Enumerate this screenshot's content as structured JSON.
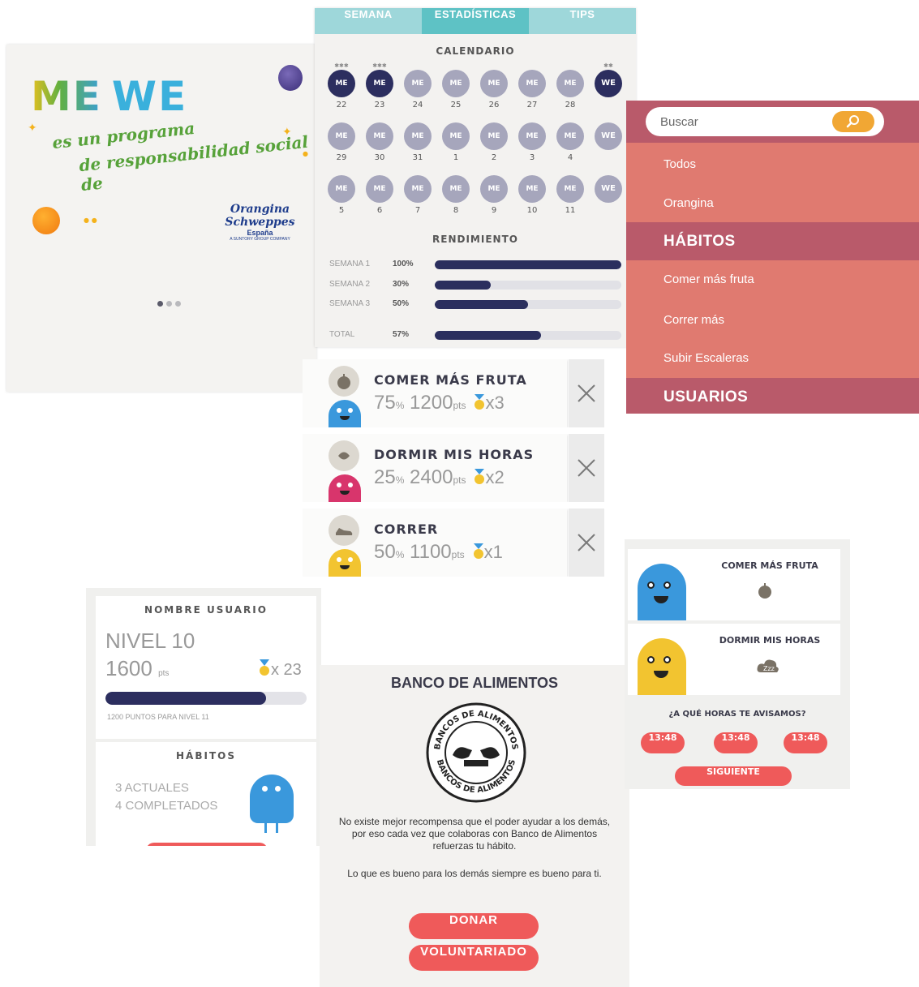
{
  "intro": {
    "logo_me": "ME",
    "logo_we": "WE",
    "tagline_1": "es un programa",
    "tagline_2": "de responsabilidad social de",
    "brand_line_1": "Orangina Schweppes",
    "brand_line_2": "España",
    "brand_line_3": "A SUNTORY GROUP COMPANY",
    "pager_active_index": 0,
    "pager_count": 3
  },
  "stats": {
    "tabs": [
      {
        "label": "SEMANA",
        "active": false
      },
      {
        "label": "ESTADÍSTICAS",
        "active": true
      },
      {
        "label": "TIPS",
        "active": false
      }
    ],
    "calendar_title": "CALENDARIO",
    "calendar": [
      {
        "top": "✱✱✱",
        "label": "ME",
        "date": "22",
        "state": "done"
      },
      {
        "top": "✱✱✱",
        "label": "ME",
        "date": "23",
        "state": "done"
      },
      {
        "top": "",
        "label": "ME",
        "date": "24",
        "state": "todo"
      },
      {
        "top": "",
        "label": "ME",
        "date": "25",
        "state": "todo"
      },
      {
        "top": "",
        "label": "ME",
        "date": "26",
        "state": "todo"
      },
      {
        "top": "",
        "label": "ME",
        "date": "27",
        "state": "todo"
      },
      {
        "top": "",
        "label": "ME",
        "date": "28",
        "state": "todo"
      },
      {
        "top": "✱✱",
        "label": "WE",
        "date": "",
        "state": "done"
      },
      {
        "top": "",
        "label": "ME",
        "date": "29",
        "state": "todo"
      },
      {
        "top": "",
        "label": "ME",
        "date": "30",
        "state": "todo"
      },
      {
        "top": "",
        "label": "ME",
        "date": "31",
        "state": "todo"
      },
      {
        "top": "",
        "label": "ME",
        "date": "1",
        "state": "todo"
      },
      {
        "top": "",
        "label": "ME",
        "date": "2",
        "state": "todo"
      },
      {
        "top": "",
        "label": "ME",
        "date": "3",
        "state": "todo"
      },
      {
        "top": "",
        "label": "ME",
        "date": "4",
        "state": "todo"
      },
      {
        "top": "",
        "label": "WE",
        "date": "",
        "state": "todo"
      },
      {
        "top": "",
        "label": "ME",
        "date": "5",
        "state": "todo"
      },
      {
        "top": "",
        "label": "ME",
        "date": "6",
        "state": "todo"
      },
      {
        "top": "",
        "label": "ME",
        "date": "7",
        "state": "todo"
      },
      {
        "top": "",
        "label": "ME",
        "date": "8",
        "state": "todo"
      },
      {
        "top": "",
        "label": "ME",
        "date": "9",
        "state": "todo"
      },
      {
        "top": "",
        "label": "ME",
        "date": "10",
        "state": "todo"
      },
      {
        "top": "",
        "label": "ME",
        "date": "11",
        "state": "todo"
      },
      {
        "top": "",
        "label": "WE",
        "date": "",
        "state": "todo"
      }
    ],
    "performance_title": "RENDIMIENTO",
    "performance": [
      {
        "label": "SEMANA 1",
        "pct_text": "100%",
        "value": 100
      },
      {
        "label": "SEMANA 2",
        "pct_text": "30%",
        "value": 30
      },
      {
        "label": "SEMANA 3",
        "pct_text": "50%",
        "value": 50
      },
      {
        "label": "TOTAL",
        "pct_text": "57%",
        "value": 57
      }
    ]
  },
  "filter": {
    "search_placeholder": "Buscar",
    "items_top": [
      "Todos",
      "Orangina"
    ],
    "section_habits": "HÁBITOS",
    "habit_items": [
      "Comer más fruta",
      "Correr más",
      "Subir Escaleras"
    ],
    "section_users": "USUARIOS"
  },
  "habits": [
    {
      "title": "COMER MÁS FRUTA",
      "pct": "75",
      "pct_unit": "%",
      "points": "1200",
      "points_unit": "pts",
      "medals": "x3",
      "icon": "apple-icon",
      "monster_color": "#3a98dc"
    },
    {
      "title": "DORMIR MIS HORAS",
      "pct": "25",
      "pct_unit": "%",
      "points": "2400",
      "points_unit": "pts",
      "medals": "x2",
      "icon": "sleep-icon",
      "monster_color": "#d8356c"
    },
    {
      "title": "CORRER",
      "pct": "50",
      "pct_unit": "%",
      "points": "1100",
      "points_unit": "pts",
      "medals": "x1",
      "icon": "shoe-icon",
      "monster_color": "#f2c430"
    }
  ],
  "profile": {
    "username": "NOMBRE USUARIO",
    "level": "NIVEL 10",
    "points": "1600",
    "points_unit": "pts",
    "medals": "x 23",
    "progress": 0.8,
    "next_level": "1200 PUNTOS PARA NIVEL 11",
    "habits_title": "HÁBITOS",
    "current": "3 ACTUALES",
    "completed": "4 COMPLETADOS"
  },
  "food": {
    "title": "BANCO DE ALIMENTOS",
    "seal_top": "BANCOS DE ALIMENTOS",
    "seal_bottom": "BANCOS DE ALIMENTOS",
    "paragraph_1": "No existe mejor recompensa que el poder ayudar a los demás, por eso cada vez que colaboras con Banco de Alimentos refuerzas tu hábito.",
    "paragraph_2": "Lo que es bueno para los demás siempre es bueno para ti.",
    "donate_label": "DONAR",
    "volunteer_label": "VOLUNTARIADO"
  },
  "reminder": {
    "cards": [
      {
        "title": "COMER MÁS FRUTA",
        "icon": "apple-icon",
        "monster_color": "#3a98dc"
      },
      {
        "title": "DORMIR MIS HORAS",
        "icon": "cloud-zzz-icon",
        "monster_color": "#f2c430"
      }
    ],
    "question": "¿A QUÉ HORAS TE AVISAMOS?",
    "times": [
      "13:48",
      "13:48",
      "13:48"
    ],
    "next_label": "SIGUIENTE"
  },
  "colors": {
    "navy": "#2c2e5f",
    "teal": "#5ec2c5",
    "coral": "#ef5a5a",
    "menu_salmon": "#e07a70",
    "menu_rose": "#b95a6a"
  }
}
